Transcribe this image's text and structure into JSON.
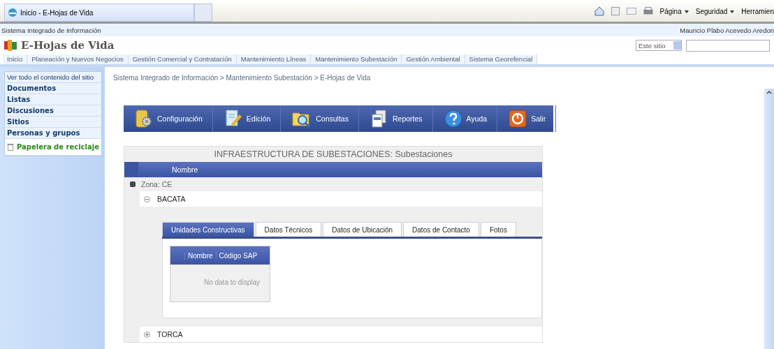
{
  "browser": {
    "tab_title": "Inicio - E-Hojas de Vida",
    "menus": [
      "Página",
      "Seguridad",
      "Herramien"
    ]
  },
  "site": {
    "title": "Sistema Integrado de Información",
    "user": "Mauricio Plabo Acevedo Aredon"
  },
  "header": {
    "title": "E-Hojas de Vida",
    "scope": "Este sitio"
  },
  "nav": [
    "Inicio",
    "Planeación y Nuevos Negocios",
    "Gestión Comercial y Contratación",
    "Mantenimiento Líneas",
    "Mantenimiento Subestación",
    "Gestión Ambiental",
    "Sistema Georefencial"
  ],
  "sidebar": {
    "items": [
      {
        "label": "Ver todo el contenido del sitio",
        "kind": "link"
      },
      {
        "label": "Documentos",
        "kind": "heading"
      },
      {
        "label": "Listas",
        "kind": "heading"
      },
      {
        "label": "Discusiones",
        "kind": "heading"
      },
      {
        "label": "Sitios",
        "kind": "heading"
      },
      {
        "label": "Personas y grupos",
        "kind": "heading"
      },
      {
        "label": "Papelera de reciclaje",
        "kind": "recycle"
      }
    ]
  },
  "breadcrumb": "Sistema Integrado de Información > Mantenimiento Subestación > E-Hojas de Vida",
  "toolbar": [
    {
      "label": "Configuración",
      "kind": "config"
    },
    {
      "label": "Edición",
      "kind": "edit"
    },
    {
      "label": "Consultas",
      "kind": "search"
    },
    {
      "label": "Reportes",
      "kind": "report"
    },
    {
      "label": "Ayuda",
      "kind": "help"
    },
    {
      "label": "Salir",
      "kind": "exit"
    }
  ],
  "grid": {
    "title": "INFRAESTRUCTURA DE SUBESTACIONES: Subestaciones",
    "column": "Nombre",
    "group": "Zona: CE",
    "rows": [
      {
        "name": "BACATA",
        "expanded": true,
        "tabs": [
          {
            "label": "Unidades Constructivas",
            "selected": true
          },
          {
            "label": "Datos Técnicos",
            "selected": false
          },
          {
            "label": "Datos de Ubicación",
            "selected": false
          },
          {
            "label": "Datos de Contacto",
            "selected": false
          },
          {
            "label": "Fotos",
            "selected": false
          }
        ],
        "detail": {
          "columns": [
            "Nombre",
            "Código SAP"
          ],
          "empty": "No data to display"
        }
      },
      {
        "name": "TORCA",
        "expanded": false
      }
    ]
  }
}
